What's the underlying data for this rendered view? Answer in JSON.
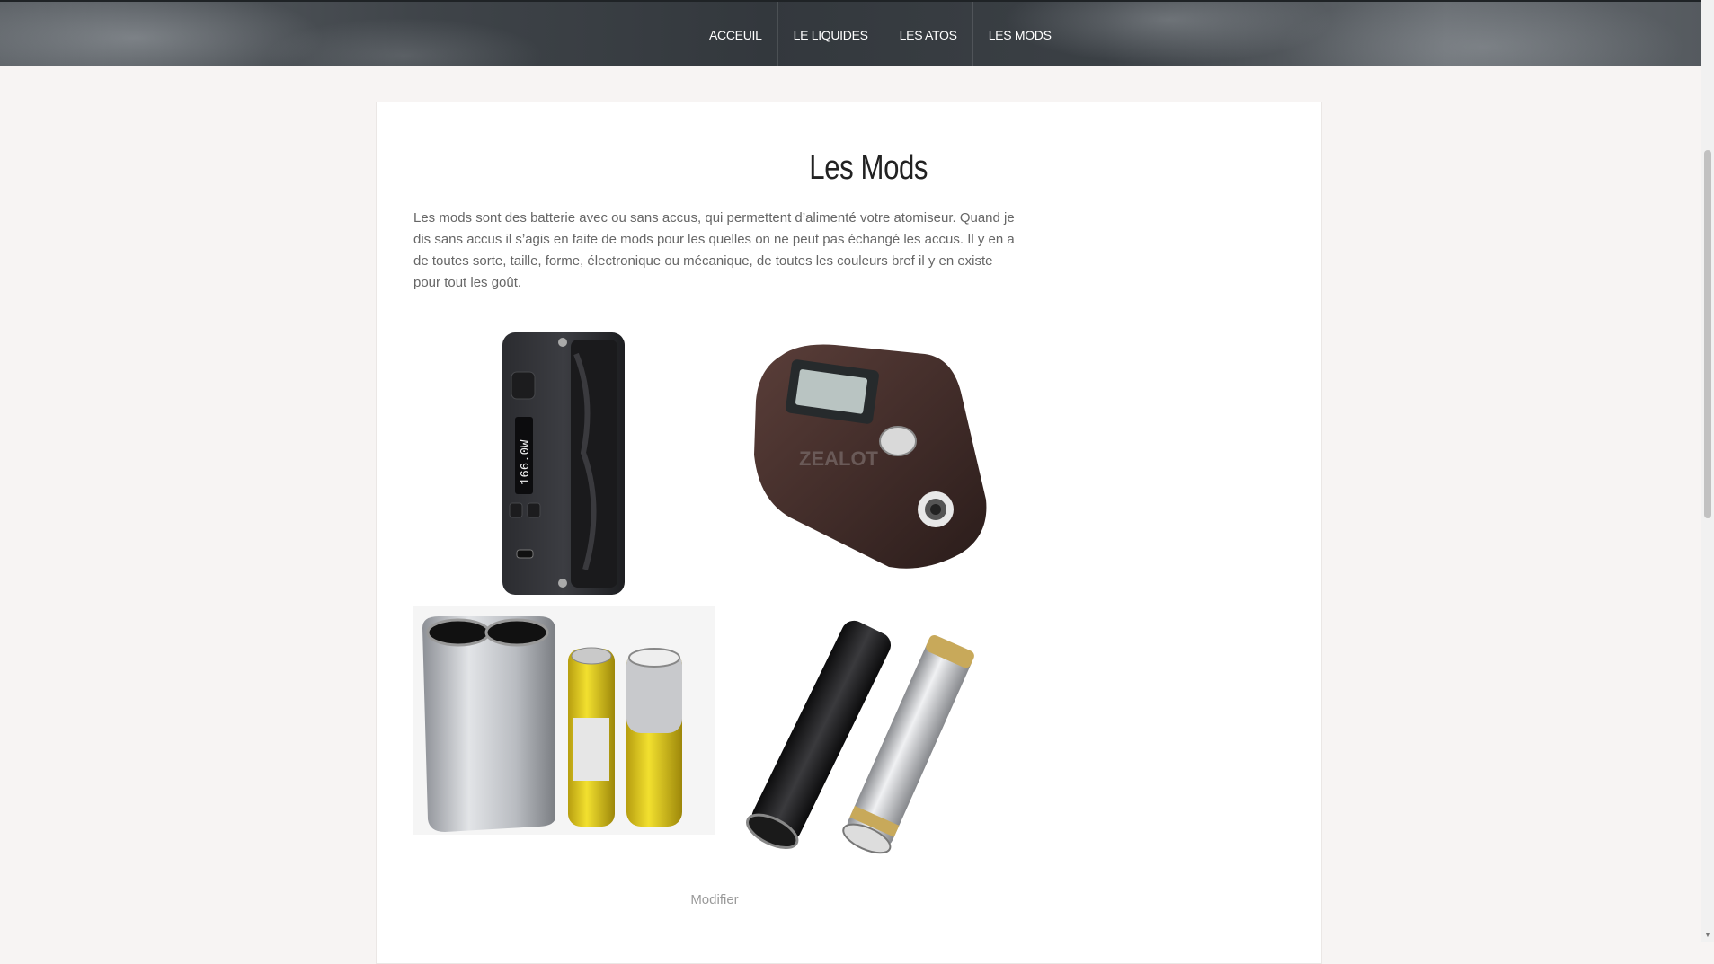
{
  "nav": {
    "items": [
      {
        "label": "ACCEUIL"
      },
      {
        "label": "LE LIQUIDES"
      },
      {
        "label": "LES ATOS"
      },
      {
        "label": "LES MODS"
      }
    ]
  },
  "page": {
    "title": "Les Mods",
    "intro": "Les mods sont des batterie avec ou sans accus, qui permettent d’alimenté votre atomiseur. Quand je dis sans accus il s’agis en faite de mods pour les quelles on ne peut pas échangé les accus. Il y en a de toutes sorte, taille,  forme, électronique ou mécanique, de toutes les couleurs bref il y en existe pour tout les goût.",
    "edit_link": "Modifier"
  },
  "images": {
    "box_mod_screen": "166.0W",
    "brown_mod_brand": "ZEALOT"
  }
}
